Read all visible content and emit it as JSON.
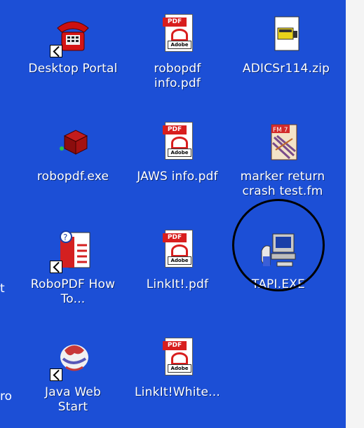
{
  "desktop": {
    "icons": [
      {
        "label": "Desktop Portal",
        "icon": "telephone-icon",
        "shortcut": true
      },
      {
        "label": "robopdf\ninfo.pdf",
        "icon": "pdf-file-icon",
        "shortcut": false
      },
      {
        "label": "ADICSr114.zip",
        "icon": "zip-archive-icon",
        "shortcut": false
      },
      {
        "label": "robopdf.exe",
        "icon": "installer-box-icon",
        "shortcut": false
      },
      {
        "label": "JAWS info.pdf",
        "icon": "pdf-file-icon",
        "shortcut": false
      },
      {
        "label": "marker return\ncrash test.fm",
        "icon": "framemaker-file-icon",
        "shortcut": false
      },
      {
        "label": "RoboPDF How\nTo...",
        "icon": "help-document-icon",
        "shortcut": true
      },
      {
        "label": "LinkIt!.pdf",
        "icon": "pdf-file-icon",
        "shortcut": false
      },
      {
        "label": "TAPI.EXE",
        "icon": "computer-phone-icon",
        "shortcut": false
      },
      {
        "label": "Java Web\nStart",
        "icon": "java-icon",
        "shortcut": true
      },
      {
        "label": "LinkIt!White...",
        "icon": "pdf-file-icon",
        "shortcut": false
      }
    ],
    "partial_labels": [
      "t",
      "ro"
    ],
    "pdf_tag": "PDF",
    "adobe_tag": "Adobe",
    "fm_tag": "FM 7",
    "highlight_color": "#000000",
    "background_color": "#1c4fd6"
  }
}
